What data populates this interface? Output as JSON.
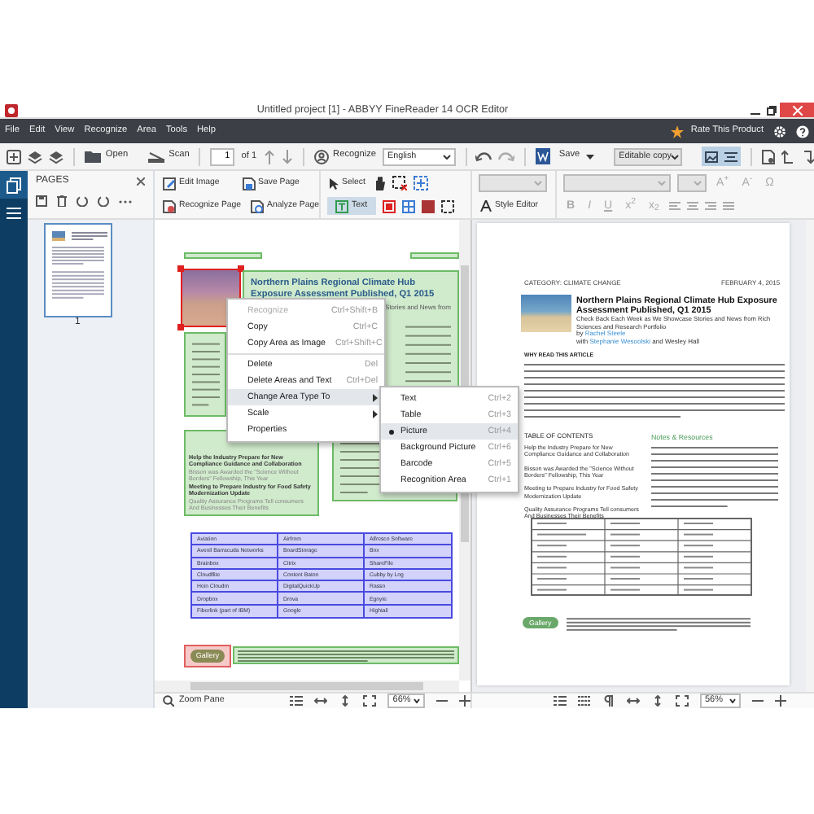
{
  "window": {
    "title": "Untitled project [1] - ABBYY FineReader 14 OCR Editor"
  },
  "menu_bar": {
    "items": [
      "File",
      "Edit",
      "View",
      "Recognize",
      "Area",
      "Tools",
      "Help"
    ],
    "rate_label": "Rate This Product"
  },
  "toolbar": {
    "open": "Open",
    "scan": "Scan",
    "page_number": "1",
    "page_total": "of 1",
    "recognize": "Recognize",
    "language": "English",
    "save": "Save",
    "save_format": "Editable copy"
  },
  "pages_panel": {
    "title": "PAGES",
    "thumbnails": [
      {
        "label": "1",
        "selected": true
      }
    ]
  },
  "ribbon": {
    "buttons": [
      "Edit Image",
      "Save Page",
      "Recognize Page",
      "Analyze Page"
    ],
    "select": "Select",
    "text_tool": {
      "label": "Text",
      "selected": true
    },
    "style_editor": "Style Editor",
    "font_size_buttons": [
      "A$^{+}$",
      "A$^{-}$"
    ],
    "symbol": "Ω",
    "format_buttons": [
      "B",
      "I",
      "U",
      "x$^{2}$",
      "x$_{2}$"
    ]
  },
  "image_pane": {
    "heading": "Northern Plains Regional Climate Hub Exposure Assessment Published, Q1 2015",
    "subtitle": "Stories and News from",
    "toc_items": [
      {
        "text": "Help the Industry Prepare for New Compliance Guidance and Collaboration",
        "kind": "heading"
      },
      {
        "text": "Bisson was Awarded the \"Science Without Borders\" Fellowship, This Year",
        "kind": "summary"
      },
      {
        "text": "Meeting to Prepare Industry for Food Safety Modernization Update",
        "kind": "heading"
      },
      {
        "text": "Quality Assurance Programs Tell consumers And Businesses Their Benefits",
        "kind": "summary"
      }
    ],
    "table_rows": [
      [
        "Aviation",
        "Airfrom",
        "Alfresco Software"
      ],
      [
        "Avenil Barracuda Networks",
        "BoardStorage",
        "Box"
      ],
      [
        "Brainbox",
        "Citrix",
        "ShareFile"
      ],
      [
        "Cloudflite",
        "Content Baton",
        "Cubby by Log"
      ],
      [
        "Hein Cloudm",
        "DigitalQuickUp",
        "Rasso"
      ],
      [
        "Dropbox",
        "Drova",
        "Egnyte"
      ],
      [
        "Fiberlink (part of IBM)",
        "Google",
        "Hightail"
      ]
    ],
    "gallery": "Gallery",
    "zoom_label": "Zoom Pane",
    "zoom": "66%"
  },
  "context_menu": {
    "items": [
      {
        "label": "Recognize",
        "shortcut": "Ctrl+Shift+B",
        "disabled": true,
        "kind": "item"
      },
      {
        "label": "Copy",
        "shortcut": "Ctrl+C",
        "disabled": false,
        "kind": "item"
      },
      {
        "label": "Copy Area as Image",
        "shortcut": "Ctrl+Shift+C",
        "disabled": false,
        "kind": "item"
      },
      {
        "kind": "divider"
      },
      {
        "label": "Delete",
        "shortcut": "Del",
        "disabled": false,
        "kind": "item"
      },
      {
        "label": "Delete Areas and Text",
        "shortcut": "Ctrl+Del",
        "disabled": false,
        "kind": "item"
      },
      {
        "label": "Change Area Type To",
        "disabled": false,
        "kind": "submenu",
        "expanded": true
      },
      {
        "label": "Scale",
        "disabled": false,
        "kind": "submenu",
        "expanded": false
      },
      {
        "label": "Properties",
        "disabled": false,
        "kind": "item"
      }
    ]
  },
  "submenu": {
    "items": [
      {
        "label": "Text",
        "shortcut": "Ctrl+2",
        "selected": false
      },
      {
        "label": "Table",
        "shortcut": "Ctrl+3",
        "selected": false
      },
      {
        "label": "Picture",
        "shortcut": "Ctrl+4",
        "selected": true
      },
      {
        "label": "Background Picture",
        "shortcut": "Ctrl+6",
        "selected": false
      },
      {
        "label": "Barcode",
        "shortcut": "Ctrl+5",
        "selected": false
      },
      {
        "label": "Recognition Area",
        "shortcut": "Ctrl+1",
        "selected": false
      }
    ]
  },
  "text_pane": {
    "category": "CATEGORY: CLIMATE CHANGE",
    "date": "FEBRUARY 4, 2015",
    "heading": "Northern Plains Regional Climate Hub Exposure Assessment Published, Q1 2015",
    "subtitle": "Check Back Each Week as We Showcase Stories and News from Rich Sciences and Research Portfolio",
    "byline_prefix": "by",
    "author": "Rachel Steele",
    "coauthor_prefix": "with",
    "coauthor": "Stephanie Wesoolski",
    "coauthor_suffix": "and Wesley Hall",
    "section": "WHY READ THIS ARTICLE",
    "toc_title": "TABLE OF CONTENTS",
    "notes_title": "Notes & Resources",
    "toc_items": [
      "Help the Industry Prepare for New Compliance Guidance and Collaboration",
      "Bisson was Awarded the \"Science Without Borders\" Fellowship, This Year",
      "Meeting to Prepare Industry for Food Safety Modernization Update",
      "Quality Assurance Programs Tell consumers And Businesses Their Benefits"
    ],
    "gallery": "Gallery",
    "zoom": "56%"
  }
}
